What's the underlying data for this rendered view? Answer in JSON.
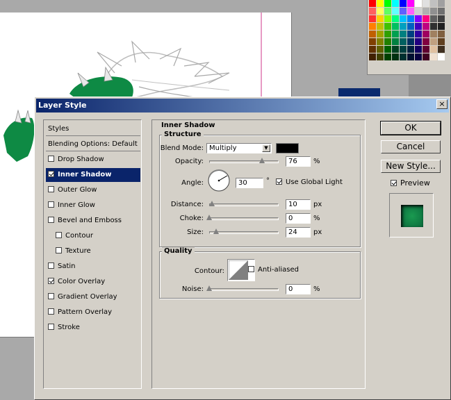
{
  "dialog": {
    "title": "Layer Style",
    "close_glyph": "×"
  },
  "style_list": {
    "header": "Styles",
    "blending_options": "Blending Options: Default",
    "items": [
      {
        "label": "Drop Shadow",
        "checked": false
      },
      {
        "label": "Inner Shadow",
        "checked": true,
        "selected": true
      },
      {
        "label": "Outer Glow",
        "checked": false
      },
      {
        "label": "Inner Glow",
        "checked": false
      },
      {
        "label": "Bevel and Emboss",
        "checked": false
      },
      {
        "label": "Contour",
        "checked": false,
        "sub": true
      },
      {
        "label": "Texture",
        "checked": false,
        "sub": true
      },
      {
        "label": "Satin",
        "checked": false
      },
      {
        "label": "Color Overlay",
        "checked": true
      },
      {
        "label": "Gradient Overlay",
        "checked": false
      },
      {
        "label": "Pattern Overlay",
        "checked": false
      },
      {
        "label": "Stroke",
        "checked": false
      }
    ]
  },
  "inner_shadow": {
    "heading": "Inner Shadow",
    "structure": {
      "title": "Structure",
      "blend_mode_label": "Blend Mode:",
      "blend_mode_value": "Multiply",
      "shadow_color": "#000000",
      "opacity_label": "Opacity:",
      "opacity_value": "76",
      "opacity_unit": "%",
      "opacity_level": 0.76,
      "angle_label": "Angle:",
      "angle_value": "30",
      "angle_unit": "°",
      "use_global_light_label": "Use Global Light",
      "use_global_light_checked": true,
      "distance_label": "Distance:",
      "distance_value": "10",
      "distance_unit": "px",
      "distance_level": 0.04,
      "choke_label": "Choke:",
      "choke_value": "0",
      "choke_unit": "%",
      "choke_level": 0.0,
      "size_label": "Size:",
      "size_value": "24",
      "size_unit": "px",
      "size_level": 0.1
    },
    "quality": {
      "title": "Quality",
      "contour_label": "Contour:",
      "anti_aliased_label": "Anti-aliased",
      "anti_aliased_checked": false,
      "noise_label": "Noise:",
      "noise_value": "0",
      "noise_unit": "%",
      "noise_level": 0.0
    }
  },
  "buttons": {
    "ok": "OK",
    "cancel": "Cancel",
    "new_style": "New Style..."
  },
  "preview": {
    "label": "Preview",
    "checked": true
  },
  "colors": {
    "selection": "#0a246a",
    "dialog_bg": "#d4d0c8",
    "preview_fill": "#0a8a48",
    "art_green": "#0e8a44"
  },
  "swatches": [
    "#ff0000",
    "#ffff00",
    "#00ff00",
    "#00ffff",
    "#0000ff",
    "#ff00ff",
    "#ffffff",
    "#e0e0e0",
    "#c0c0c0",
    "#a0a0a0",
    "#ff6060",
    "#ffff60",
    "#60ff60",
    "#60ffff",
    "#6060ff",
    "#ff60ff",
    "#d0d0d0",
    "#b0b0b0",
    "#909090",
    "#707070",
    "#ff3030",
    "#ffd000",
    "#80ff00",
    "#00ff80",
    "#00c0ff",
    "#0080ff",
    "#8000ff",
    "#ff0080",
    "#606060",
    "#404040",
    "#ff8000",
    "#c0c000",
    "#40c000",
    "#00c060",
    "#00a0c0",
    "#0060c0",
    "#4000c0",
    "#c00080",
    "#303030",
    "#202020",
    "#c06000",
    "#a0a000",
    "#30a000",
    "#00a050",
    "#008080",
    "#004080",
    "#3000a0",
    "#a00060",
    "#a08060",
    "#806040",
    "#804000",
    "#808000",
    "#208000",
    "#008040",
    "#006060",
    "#003060",
    "#200080",
    "#800040",
    "#c0a080",
    "#604020",
    "#603000",
    "#606000",
    "#006000",
    "#004020",
    "#004040",
    "#002040",
    "#100060",
    "#600030",
    "#e0c0a0",
    "#403020",
    "#402000",
    "#404000",
    "#004000",
    "#003010",
    "#003030",
    "#001030",
    "#080040",
    "#400020",
    "#f0e0d0",
    "#ffffff"
  ]
}
